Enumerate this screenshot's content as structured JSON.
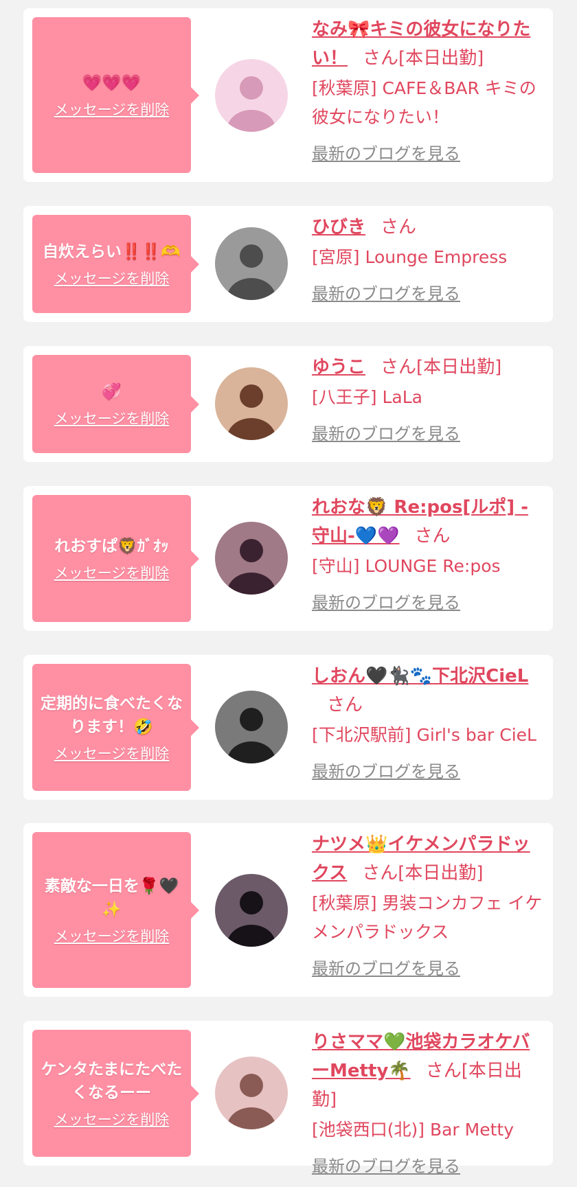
{
  "labels": {
    "delete": "メッセージを削除",
    "san": "さん",
    "blog": "最新のブログを見る"
  },
  "cards": [
    {
      "message": "💗💗💗",
      "name": "なみ🎀キミの彼女になりたい！",
      "status": "[本日出勤]",
      "shop": "[秋葉原] CAFE＆BAR キミの彼女になりたい！",
      "avatar_colors": [
        "#f6d6e6",
        "#d79ab8"
      ]
    },
    {
      "message": "自炊えらい‼️‼️🫶",
      "name": "ひびき",
      "status": "",
      "shop": "[宮原] Lounge Empress",
      "avatar_colors": [
        "#9a9a9a",
        "#4d4d4d"
      ]
    },
    {
      "message": "💞",
      "name": "ゆうこ",
      "status": "[本日出勤]",
      "shop": "[八王子] LaLa",
      "avatar_colors": [
        "#d9b49a",
        "#6b3f2b"
      ]
    },
    {
      "message": "れおすぱ🦁ｶﾞｵｯ",
      "name": "れおな🦁 Re:pos[ルポ] -守山-💙💜",
      "status": "",
      "shop": "[守山] LOUNGE Re:pos",
      "avatar_colors": [
        "#a07a86",
        "#3b2230"
      ]
    },
    {
      "message": "定期的に食べたくなります！🤣",
      "name": "しおん🖤🐈‍⬛🐾下北沢CieL",
      "status": "",
      "shop": "[下北沢駅前] Girl's bar CieL",
      "avatar_colors": [
        "#7a7a7a",
        "#1f1f1f"
      ]
    },
    {
      "message": "素敵な一日を🌹🖤✨",
      "name": "ナツメ👑イケメンパラドックス",
      "status": "[本日出勤]",
      "shop": "[秋葉原] 男装コンカフェ イケメンパラドックス",
      "avatar_colors": [
        "#6c5a68",
        "#161218"
      ]
    },
    {
      "message": "ケンタたまにたべたくなるーー",
      "name": "りさママ💚池袋カラオケバーMetty🌴",
      "status": "[本日出勤]",
      "shop": "[池袋西口(北)] Bar Metty",
      "avatar_colors": [
        "#e7c2c2",
        "#8a5b55"
      ]
    }
  ]
}
